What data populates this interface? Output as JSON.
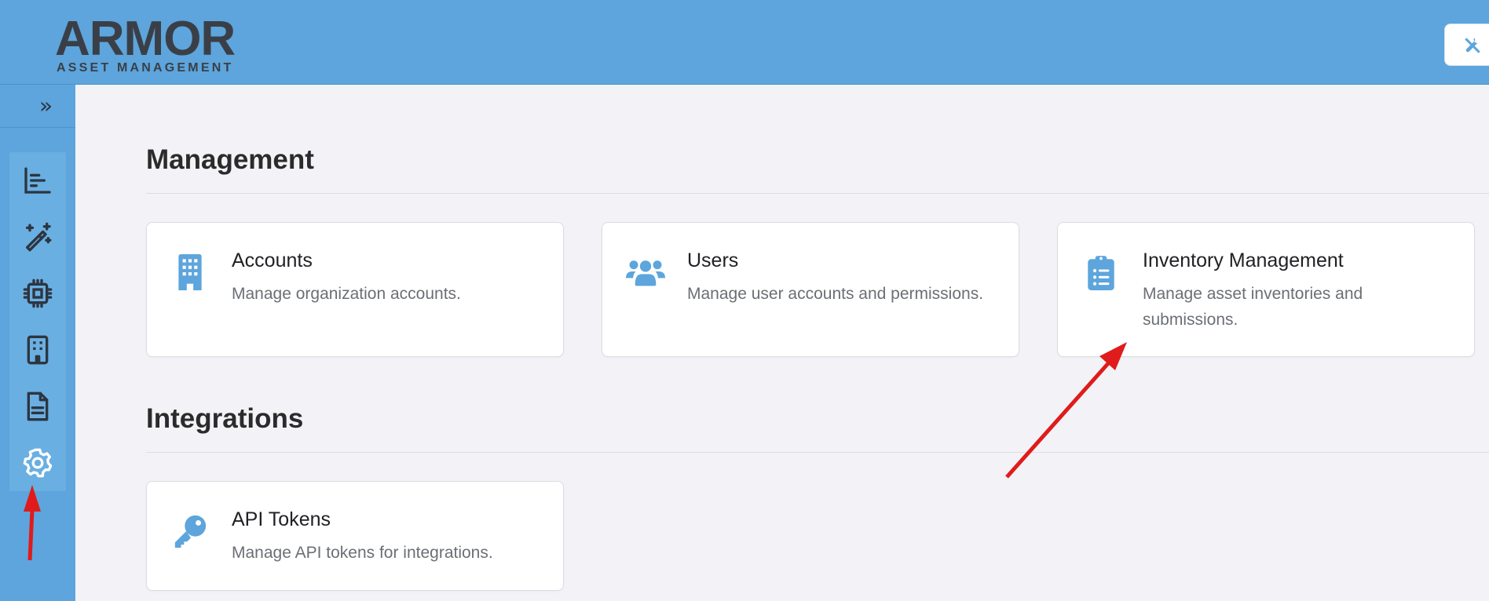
{
  "header": {
    "logo_text": "ARMOR",
    "logo_subtitle": "ASSET MANAGEMENT",
    "tools_icon": "tools-icon"
  },
  "sidebar": {
    "expand_icon": "double-chevron-right-icon",
    "expand_glyph": "»",
    "items": [
      {
        "icon": "bar-chart-icon"
      },
      {
        "icon": "magic-wand-icon"
      },
      {
        "icon": "cpu-chip-icon"
      },
      {
        "icon": "building-icon"
      },
      {
        "icon": "document-icon"
      },
      {
        "icon": "gear-icon",
        "active": true
      }
    ]
  },
  "sections": [
    {
      "title": "Management",
      "cards": [
        {
          "icon": "building-icon",
          "title": "Accounts",
          "description": "Manage organization accounts."
        },
        {
          "icon": "users-icon",
          "title": "Users",
          "description": "Manage user accounts and permissions."
        },
        {
          "icon": "clipboard-list-icon",
          "title": "Inventory Management",
          "description": "Manage asset inventories and submissions."
        }
      ]
    },
    {
      "title": "Integrations",
      "cards": [
        {
          "icon": "key-icon",
          "title": "API Tokens",
          "description": "Manage API tokens for integrations."
        }
      ]
    }
  ],
  "colors": {
    "header_bg": "#5da5dc",
    "icon_blue": "#5da5dc",
    "annotation_red": "#e01b1b"
  }
}
